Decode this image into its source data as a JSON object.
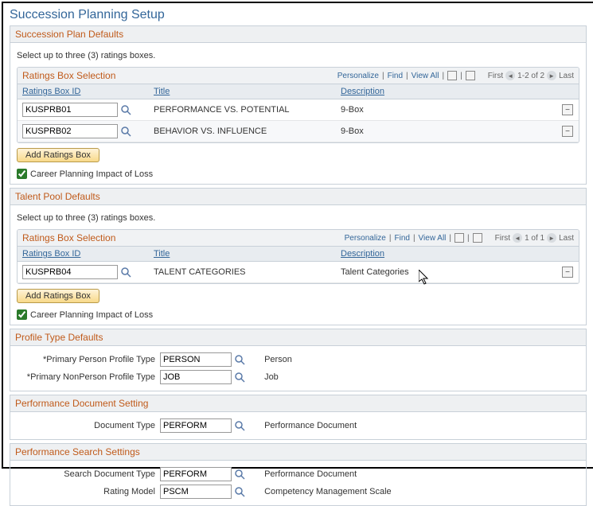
{
  "page_title": "Succession Planning Setup",
  "sections": {
    "succ_defaults": {
      "header": "Succession Plan Defaults",
      "instruction": "Select up to three (3) ratings boxes.",
      "grid": {
        "title": "Ratings Box Selection",
        "tools": {
          "personalize": "Personalize",
          "find": "Find",
          "view_all": "View All"
        },
        "nav": {
          "first": "First",
          "pos": "1-2 of 2",
          "last": "Last"
        },
        "headers": {
          "id": "Ratings Box ID",
          "title": "Title",
          "desc": "Description"
        },
        "rows": [
          {
            "id": "KUSPRB01",
            "title": "PERFORMANCE VS. POTENTIAL",
            "desc": "9-Box"
          },
          {
            "id": "KUSPRB02",
            "title": "BEHAVIOR VS. INFLUENCE",
            "desc": "9-Box"
          }
        ]
      },
      "add_label": "Add Ratings Box",
      "impact_label": "Career Planning Impact of Loss",
      "impact_checked": true
    },
    "talent_defaults": {
      "header": "Talent Pool Defaults",
      "instruction": "Select up to three (3) ratings boxes.",
      "grid": {
        "title": "Ratings Box Selection",
        "tools": {
          "personalize": "Personalize",
          "find": "Find",
          "view_all": "View All"
        },
        "nav": {
          "first": "First",
          "pos": "1 of 1",
          "last": "Last"
        },
        "headers": {
          "id": "Ratings Box ID",
          "title": "Title",
          "desc": "Description"
        },
        "rows": [
          {
            "id": "KUSPRB04",
            "title": "TALENT CATEGORIES",
            "desc": "Talent Categories"
          }
        ]
      },
      "add_label": "Add Ratings Box",
      "impact_label": "Career Planning Impact of Loss",
      "impact_checked": true
    },
    "profile_defaults": {
      "header": "Profile Type Defaults",
      "rows": [
        {
          "label": "*Primary Person Profile Type",
          "value": "PERSON",
          "desc": "Person"
        },
        {
          "label": "*Primary NonPerson Profile Type",
          "value": "JOB",
          "desc": "Job"
        }
      ]
    },
    "perf_doc": {
      "header": "Performance Document Setting",
      "rows": [
        {
          "label": "Document Type",
          "value": "PERFORM",
          "desc": "Performance Document"
        }
      ]
    },
    "perf_search": {
      "header": "Performance Search Settings",
      "rows": [
        {
          "label": "Search Document Type",
          "value": "PERFORM",
          "desc": "Performance Document"
        },
        {
          "label": "Rating Model",
          "value": "PSCM",
          "desc": "Competency Management Scale"
        }
      ]
    }
  }
}
